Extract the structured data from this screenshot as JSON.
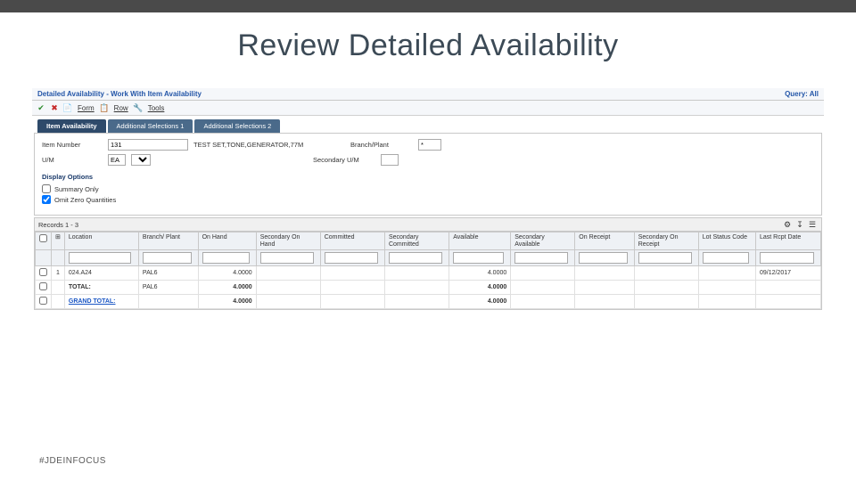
{
  "slide": {
    "title": "Review Detailed Availability",
    "footer_tag": "#JDEINFOCUS"
  },
  "app": {
    "window_title": "Detailed Availability - Work With Item Availability",
    "query_label": "Query: All"
  },
  "toolbar": {
    "form": "Form",
    "row": "Row",
    "tools": "Tools"
  },
  "tabs": {
    "tab1": "Item Availability",
    "tab2": "Additional Selections 1",
    "tab3": "Additional Selections 2"
  },
  "form": {
    "item_number_label": "Item Number",
    "item_number_value": "131",
    "item_desc": "TEST SET,TONE,GENERATOR,77M",
    "um_label": "U/M",
    "um_value": "EA",
    "branch_label": "Branch/Plant",
    "branch_value": "*",
    "secondary_um_label": "Secondary U/M",
    "display_options": "Display Options",
    "summary_only": "Summary Only",
    "omit_zero": "Omit Zero Quantities"
  },
  "grid": {
    "records_label": "Records 1 - 3",
    "columns": {
      "sel": "",
      "icon": "",
      "location": "Location",
      "branch_plant": "Branch/\nPlant",
      "on_hand": "On Hand",
      "secondary_on_hand": "Secondary\nOn Hand",
      "committed": "Committed",
      "secondary_committed": "Secondary\nCommitted",
      "available": "Available",
      "secondary_available": "Secondary\nAvailable",
      "on_receipt": "On Receipt",
      "secondary_on_receipt": "Secondary\nOn Receipt",
      "lot_status": "Lot Status\nCode",
      "last_rcpt": "Last Rcpt\nDate"
    },
    "rows": [
      {
        "icon": "1",
        "location": "024.A24",
        "branch_plant": "PAL6",
        "on_hand": "4.0000",
        "available": "4.0000",
        "last_rcpt": "09/12/2017"
      },
      {
        "location": "TOTAL:",
        "branch_plant": "PAL6",
        "on_hand": "4.0000",
        "available": "4.0000",
        "bold": true
      },
      {
        "location": "GRAND TOTAL:",
        "on_hand": "4.0000",
        "available": "4.0000",
        "bold": true,
        "link": true
      }
    ]
  }
}
